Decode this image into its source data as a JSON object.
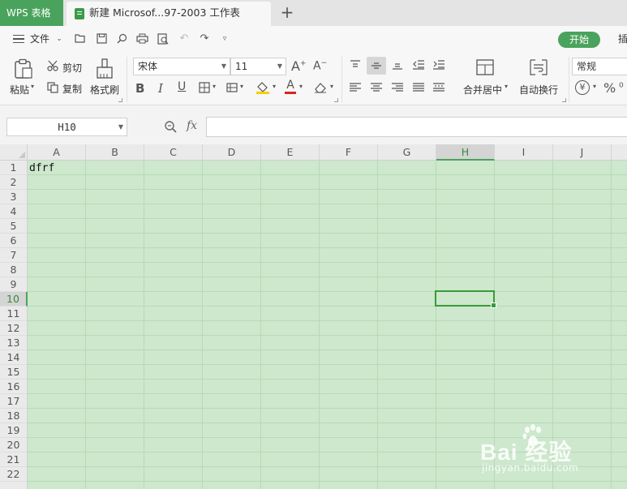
{
  "titlebar": {
    "app_tab": "WPS 表格",
    "doc_tab": "新建 Microsof...97-2003 工作表"
  },
  "menu": {
    "file": "文件",
    "start": "开始",
    "insert_partial": "插"
  },
  "ribbon": {
    "paste": "粘贴",
    "cut": "剪切",
    "copy": "复制",
    "format_painter": "格式刷",
    "font_name": "宋体",
    "font_size": "11",
    "merge_center": "合并居中",
    "wrap_text": "自动换行",
    "number_format": "常规",
    "font_color": "#e02020",
    "fill_color": "#f5d000"
  },
  "formula": {
    "namebox": "H10",
    "fx": "fx",
    "value": ""
  },
  "sheet": {
    "columns": [
      "A",
      "B",
      "C",
      "D",
      "E",
      "F",
      "G",
      "H",
      "I",
      "J"
    ],
    "active_column": "H",
    "rows": [
      "1",
      "2",
      "3",
      "4",
      "5",
      "6",
      "7",
      "8",
      "9",
      "10",
      "11",
      "12",
      "13",
      "14",
      "15",
      "16",
      "17",
      "18",
      "19",
      "20",
      "21",
      "22"
    ],
    "active_row": "10",
    "cells": {
      "A1": "dfrf"
    }
  },
  "watermark": {
    "brand": "Bai  经验",
    "url": "jingyan.baidu.com"
  },
  "colors": {
    "accent": "#4aa35c",
    "sheet_bg": "#cde8cd"
  }
}
